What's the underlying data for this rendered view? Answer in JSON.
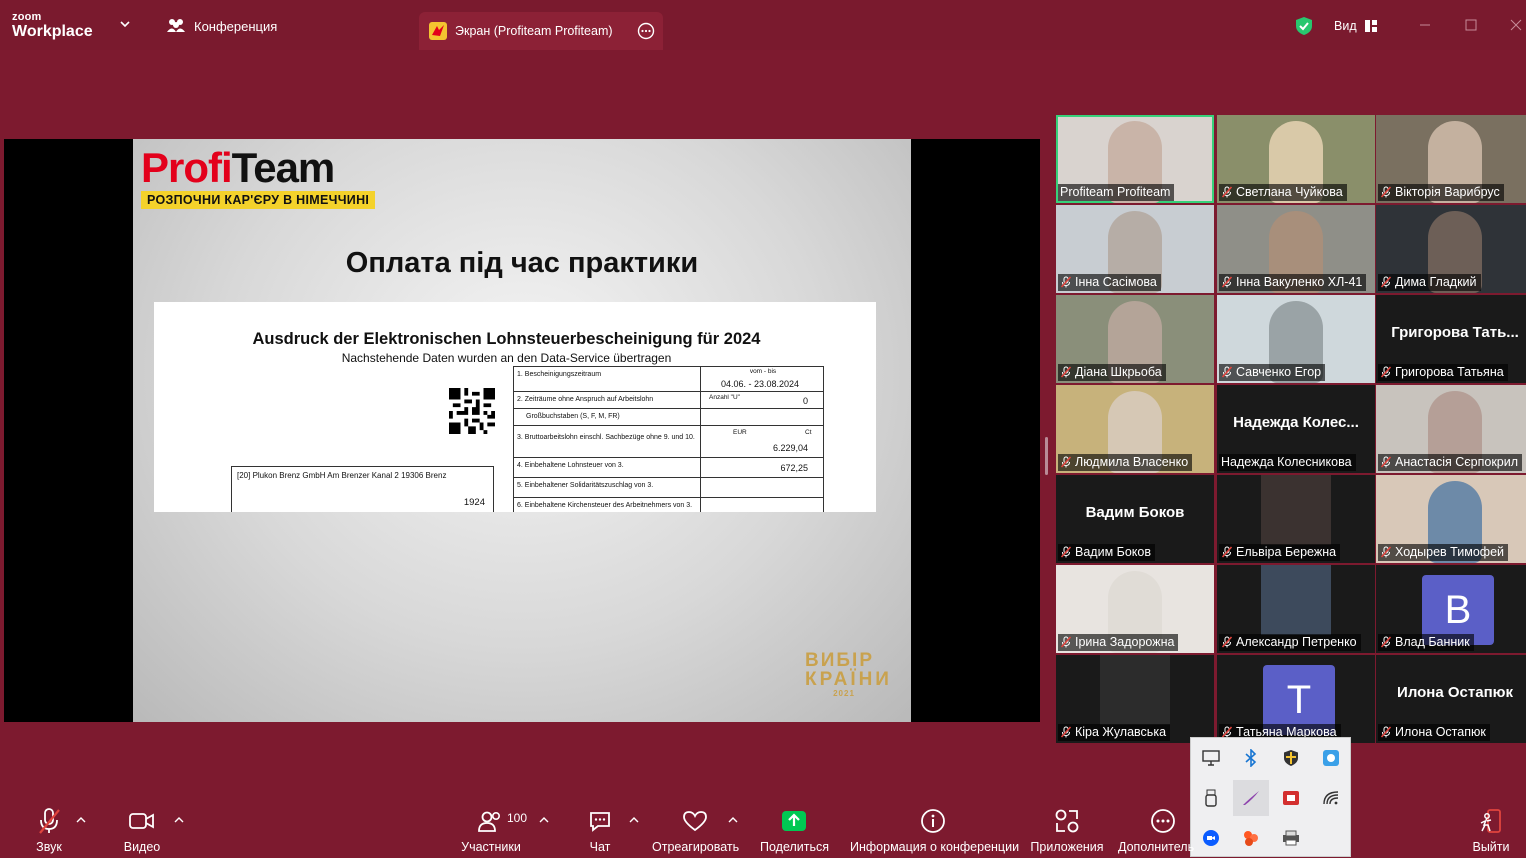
{
  "titlebar": {
    "logo_small": "zoom",
    "logo_big": "Workplace",
    "conference_tab": "Конференция",
    "screen_tab": "Экран (Profiteam Profiteam)",
    "view_label": "Вид"
  },
  "slide": {
    "brand_red": "Profi",
    "brand_black": "Team",
    "tagline": "РОЗПОЧНИ КАР'ЄРУ В НІМЕЧЧИНІ",
    "title": "Оплата під час практики",
    "doc_title": "Ausdruck der Elektronischen Lohnsteuerbescheinigung für 2024",
    "doc_subtitle": "Nachstehende Daten wurden an den Data-Service übertragen",
    "rows": [
      {
        "label": "1. Bescheinigungszeitraum",
        "head": "vom - bis",
        "value": "04.06. - 23.08.2024"
      },
      {
        "label": "2. Zeiträume ohne Anspruch auf Arbeitslohn",
        "head": "Anzahl \"U\"",
        "value": "0"
      },
      {
        "label": "Großbuchstaben (S, F, M, FR)",
        "head": "",
        "value": ""
      },
      {
        "label": "3. Bruttoarbeitslohn einschl. Sachbezüge ohne 9. und 10.",
        "head": "EUR",
        "head2": "Ct",
        "value": "6.229,04"
      },
      {
        "label": "4. Einbehaltene Lohnsteuer von 3.",
        "head": "",
        "value": "672,25"
      },
      {
        "label": "5. Einbehaltener Solidaritätszuschlag von 3.",
        "head": "",
        "value": ""
      },
      {
        "label": "6. Einbehaltene Kirchensteuer des Arbeitnehmers von 3.",
        "head": "",
        "value": ""
      }
    ],
    "employer": "[20] Plukon Brenz GmbH  Am Brenzer Kanal 2 19306 Brenz",
    "employer_number": "1924",
    "vibir_1": "ВИБІР",
    "vibir_2": "КРАЇНИ",
    "vibir_year": "2021"
  },
  "gallery": [
    {
      "name": "Profiteam Profiteam",
      "muted": false,
      "active": true,
      "big": ""
    },
    {
      "name": "Светлана Чуйкова",
      "muted": true,
      "big": ""
    },
    {
      "name": "Вікторія Варибрус",
      "muted": true,
      "big": ""
    },
    {
      "name": "Інна Сасімова",
      "muted": true,
      "big": ""
    },
    {
      "name": "Інна Вакуленко ХЛ-41",
      "muted": true,
      "big": ""
    },
    {
      "name": "Дима Гладкий",
      "muted": true,
      "big": ""
    },
    {
      "name": "Діана Шкрьоба",
      "muted": true,
      "big": ""
    },
    {
      "name": "Савченко Егор",
      "muted": true,
      "big": ""
    },
    {
      "name": "Григорова Татьяна",
      "muted": true,
      "big": "Григорова  Тать..."
    },
    {
      "name": "Людмила Власенко",
      "muted": true,
      "big": ""
    },
    {
      "name": "Надежда Колесникова",
      "muted": false,
      "big": "Надежда  Колес..."
    },
    {
      "name": "Анастасія Сєрпокрил",
      "muted": true,
      "big": ""
    },
    {
      "name": "Вадим Боков",
      "muted": true,
      "big": "Вадим Боков"
    },
    {
      "name": "Ельвіра Бережна",
      "muted": true,
      "big": ""
    },
    {
      "name": "Ходырев Тимофей",
      "muted": true,
      "big": ""
    },
    {
      "name": "Ірина Задорожна",
      "muted": true,
      "big": ""
    },
    {
      "name": "Александр Петренко",
      "muted": true,
      "big": ""
    },
    {
      "name": "Влад Банник",
      "muted": true,
      "big": "",
      "avatar": "B",
      "avatar_color": "#5b5fc7"
    },
    {
      "name": "Кіра Жулавська",
      "muted": true,
      "big": ""
    },
    {
      "name": "Татьяна Маркова",
      "muted": true,
      "big": "",
      "avatar": "T",
      "avatar_color": "#5b5fc7"
    },
    {
      "name": "Илона Остапюк",
      "muted": true,
      "big": "Илона Остапюк"
    }
  ],
  "toolbar": {
    "audio": "Звук",
    "video": "Видео",
    "participants": "Участники",
    "participants_count": "100",
    "chat": "Чат",
    "react": "Отреагировать",
    "share": "Поделиться",
    "info": "Информация о конференции",
    "apps": "Приложения",
    "more": "Дополнитель",
    "leave": "Выйти"
  },
  "colors": {
    "background": "#7d1a2f",
    "active_speaker": "#37d17a",
    "share_green": "#00c853",
    "muted_red": "#e0443e"
  }
}
